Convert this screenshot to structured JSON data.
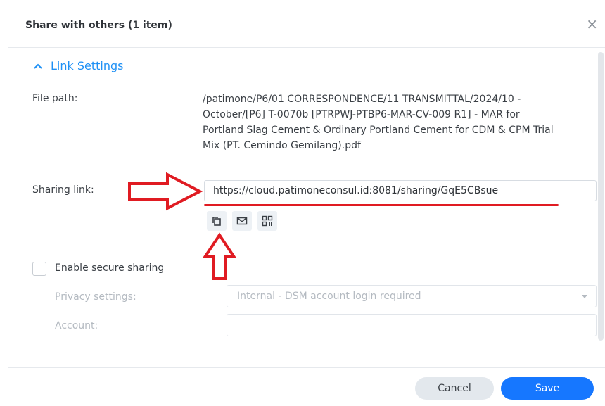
{
  "dialog": {
    "title": "Share with others (1 item)",
    "close_icon": "close-icon"
  },
  "section": {
    "label": "Link Settings",
    "icon": "chevron-up-icon",
    "accent": "#1e90f5"
  },
  "file_path": {
    "label": "File path:",
    "value": "/patimone/P6/01 CORRESPONDENCE/11 TRANSMITTAL/2024/10 - October/[P6] T-0070b [PTRPWJ-PTBP6-MAR-CV-009 R1] - MAR for Portland Slag Cement & Ordinary Portland Cement for CDM & CPM Trial Mix (PT. Cemindo Gemilang).pdf"
  },
  "sharing_link": {
    "label": "Sharing link:",
    "value": "https://cloud.patimoneconsul.id:8081/sharing/GqE5CBsue",
    "actions": [
      {
        "icon": "copy-icon"
      },
      {
        "icon": "email-icon"
      },
      {
        "icon": "qr-code-icon"
      }
    ]
  },
  "secure_sharing": {
    "checkbox_label": "Enable secure sharing",
    "checked": false,
    "privacy_label": "Privacy settings:",
    "privacy_value": "Internal - DSM account login required",
    "account_label": "Account:",
    "account_value": ""
  },
  "buttons": {
    "cancel": "Cancel",
    "save": "Save",
    "save_color": "#1677ff"
  },
  "annotation_color": "#e01b22"
}
